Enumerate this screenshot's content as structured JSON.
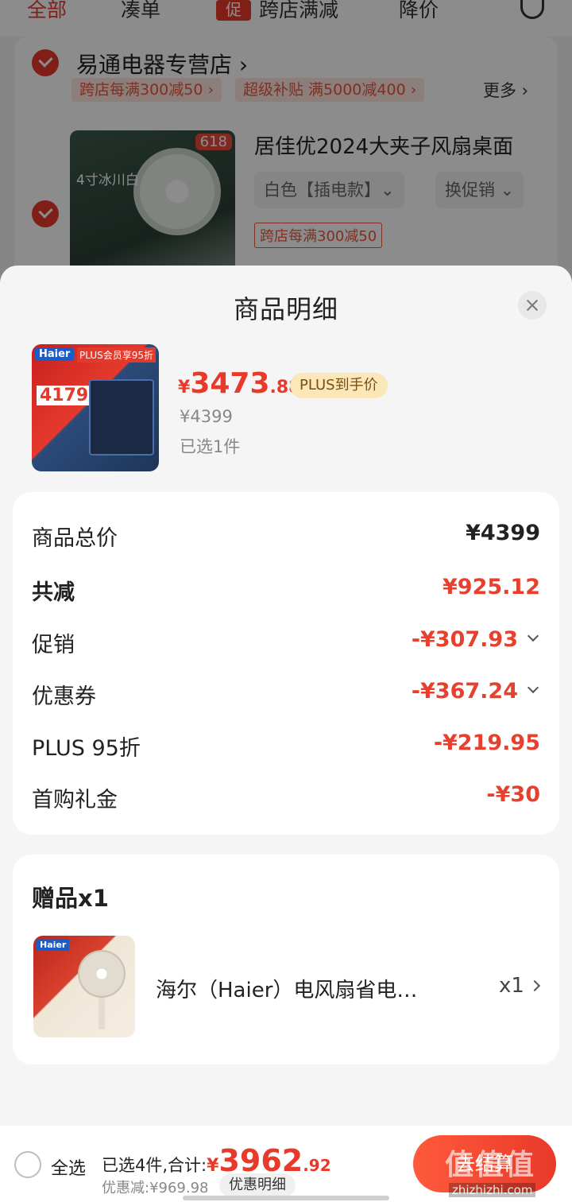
{
  "background": {
    "nav_tabs": [
      "全部",
      "凑单",
      "跨店满减",
      "降价"
    ],
    "promo_chip": "促",
    "store_name": "易通电器专营店 ›",
    "store_promos": [
      "跨店每满300减50 ›",
      "超级补贴 满5000减400 ›"
    ],
    "more": "更多 ›",
    "item_title": "居佳优2024大夹子风扇桌面",
    "item_variant": "白色【插电款】⌄",
    "item_promo_switch": "换促销 ⌄",
    "item_promo_tag": "跨店每满300减50",
    "item_img_tag": "618",
    "item_img_text": "4寸冰川白"
  },
  "sheet": {
    "title": "商品明细",
    "product": {
      "img_brand": "Haier",
      "img_plus": "PLUS会员享95折",
      "img_price": "4179",
      "price_currency": "¥",
      "price_int": "3473",
      "price_dec": ".88",
      "plus_badge": "PLUS到手价",
      "original_price": "¥4399",
      "selected_count": "已选1件"
    },
    "summary": {
      "total": {
        "label": "商品总价",
        "value": "¥4399"
      },
      "reduced": {
        "label": "共减",
        "value": "¥925.12"
      },
      "promo": {
        "label": "促销",
        "value": "-¥307.93"
      },
      "coupon": {
        "label": "优惠券",
        "value": "-¥367.24"
      },
      "plus95": {
        "label": "PLUS 95折",
        "value": "-¥219.95"
      },
      "first_gift": {
        "label": "首购礼金",
        "value": "-¥30"
      }
    },
    "gift": {
      "title": "赠品x1",
      "img_brand": "Haier",
      "name": "海尔（Haier）电风扇省电…",
      "qty": "x1"
    }
  },
  "bottom": {
    "select_all": "全选",
    "selected_summary": "已选4件,合计:",
    "total_currency": "¥",
    "total_int": "3962",
    "total_dec": ".92",
    "discount": "优惠减:¥969.98",
    "discount_detail_button": "优惠明细",
    "checkout": "去结算",
    "watermark": "值值值",
    "watermark_sub": "zhizhizhi.com"
  },
  "colors": {
    "accent": "#e83a2a",
    "plus_gold": "#fbe7b7"
  }
}
